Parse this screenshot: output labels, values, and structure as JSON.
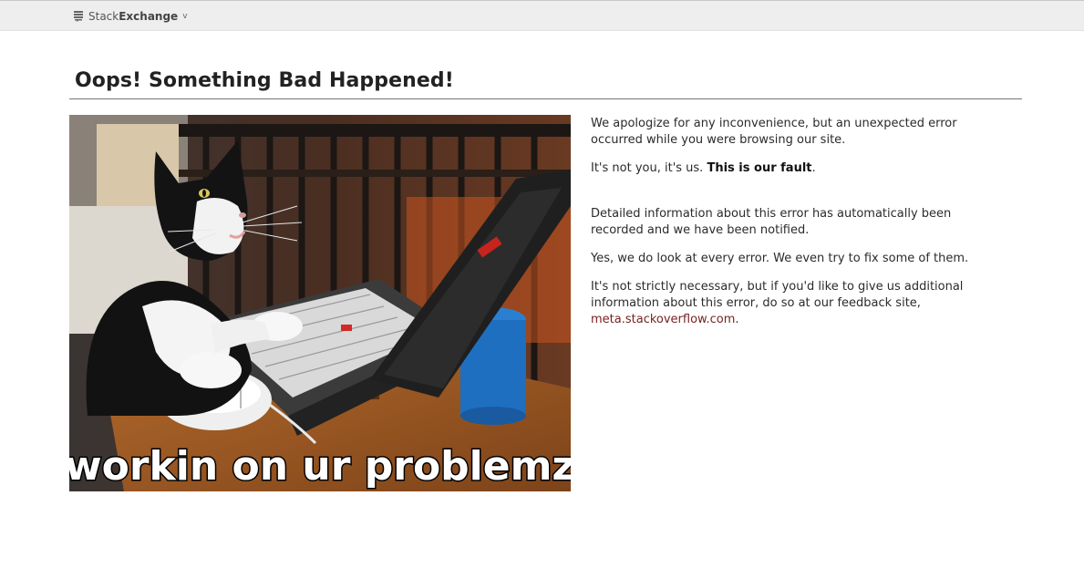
{
  "topbar": {
    "brand_light": "Stack",
    "brand_bold": "Exchange",
    "caret": "v"
  },
  "page": {
    "title": "Oops! Something Bad Happened!"
  },
  "image": {
    "caption": "workin on ur problemz"
  },
  "messages": {
    "p1": "We apologize for any inconvenience, but an unexpected error occurred while you were browsing our site.",
    "p2_prefix": "It's not you, it's us. ",
    "p2_bold": "This is our fault",
    "p2_suffix": ".",
    "p3": "Detailed information about this error has automatically been recorded and we have been notified.",
    "p4": "Yes, we do look at every error. We even try to fix some of them.",
    "p5_prefix": "It's not strictly necessary, but if you'd like to give us additional information about this error, do so at our feedback site, ",
    "p5_link": "meta.stackoverflow.com",
    "p5_suffix": "."
  },
  "colors": {
    "link": "#772222",
    "topbar_bg": "#eeeeee"
  }
}
